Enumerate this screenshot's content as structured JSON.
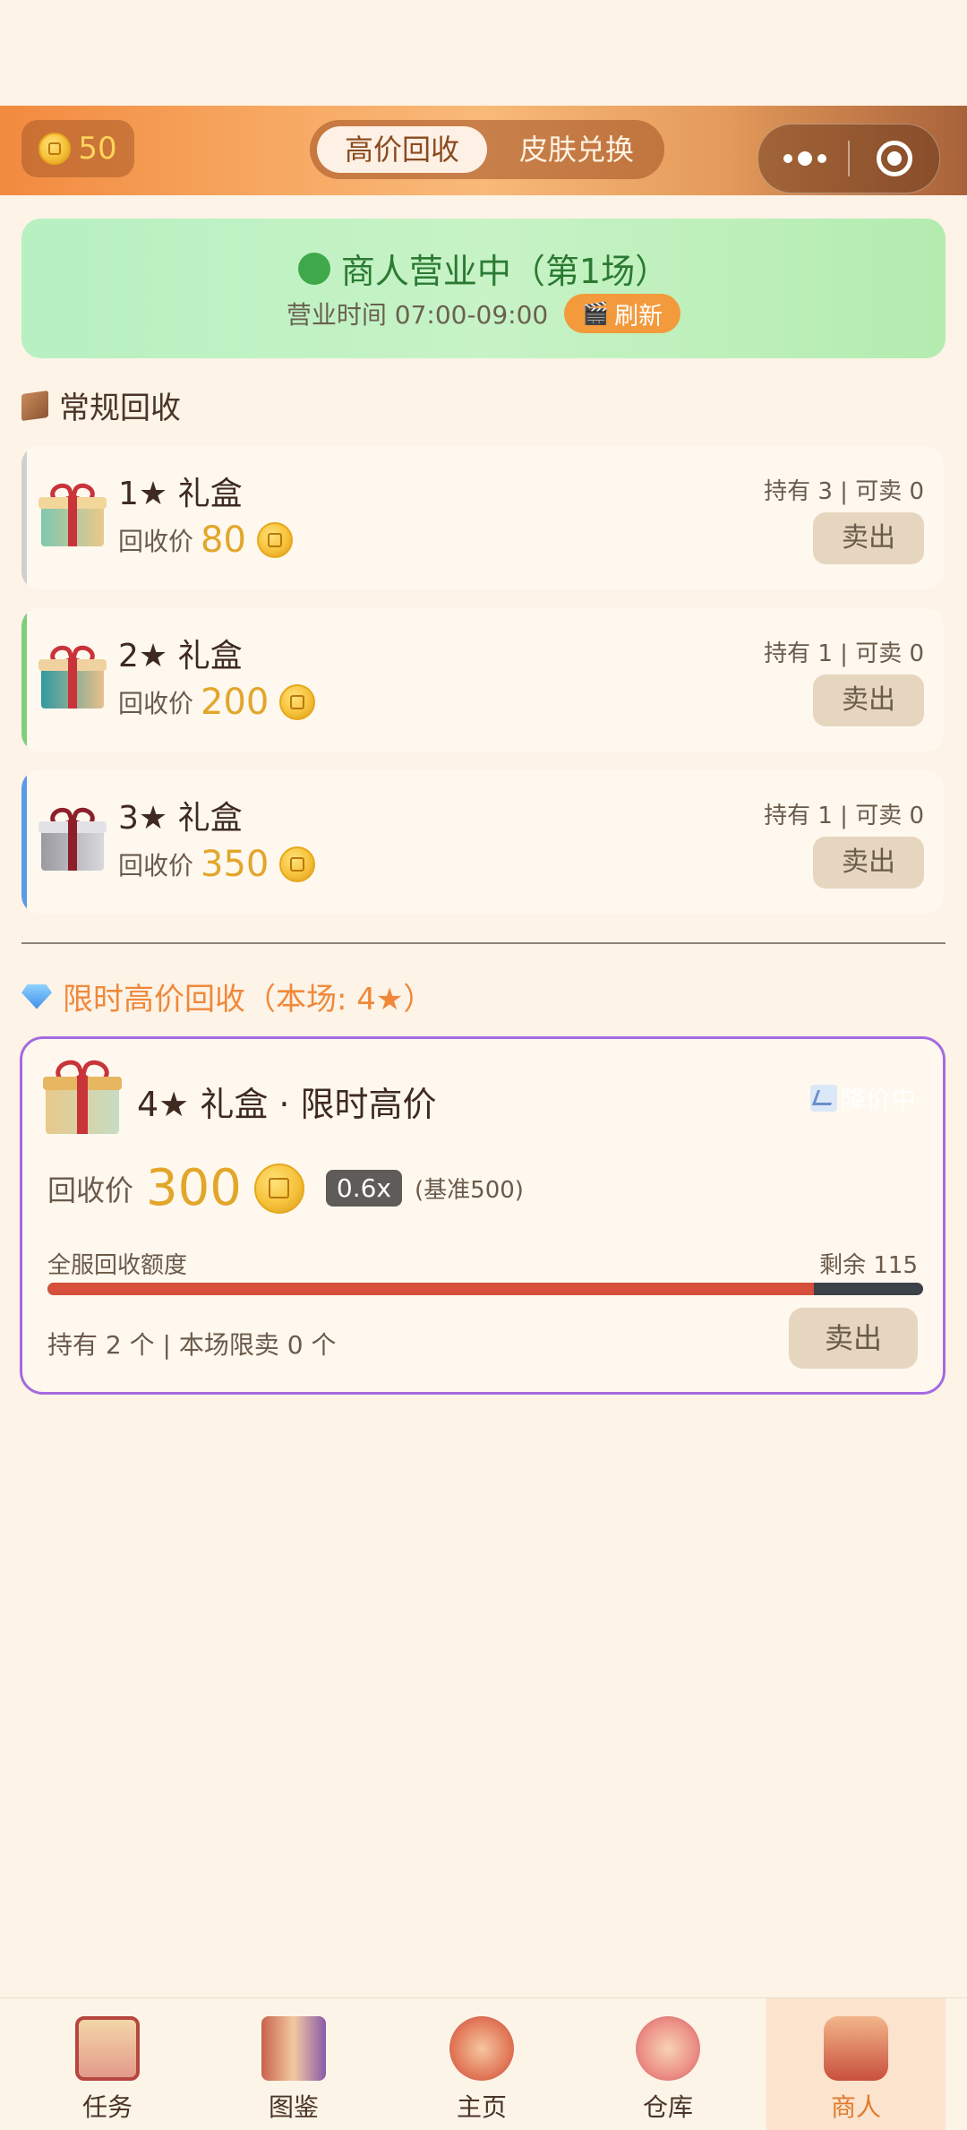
{
  "header": {
    "coin_balance": "50",
    "tabs": [
      "高价回收",
      "皮肤兑换"
    ],
    "active_tab": 0
  },
  "status": {
    "title": "商人营业中（第1场）",
    "hours": "营业时间 07:00-09:00",
    "refresh_label": "刷新"
  },
  "regular": {
    "title": "常规回收",
    "price_label": "回收价",
    "sell_label": "卖出",
    "items": [
      {
        "name": "1★ 礼盒",
        "price": "80",
        "holding": "持有 3 | 可卖 0",
        "accent": "#cccccc"
      },
      {
        "name": "2★ 礼盒",
        "price": "200",
        "holding": "持有 1 | 可卖 0",
        "accent": "#7fcf7a"
      },
      {
        "name": "3★ 礼盒",
        "price": "350",
        "holding": "持有 1 | 可卖 0",
        "accent": "#5b9be8"
      }
    ]
  },
  "limited": {
    "title": "限时高价回收（本场: 4★）",
    "name": "4★ 礼盒 · 限时高价",
    "trend": "降价中",
    "price_label": "回收价",
    "price": "300",
    "multiplier": "0.6x",
    "base": "(基准500)",
    "quota_label": "全服回收额度",
    "remaining": "剩余 115",
    "quota_used_fraction": 0.875,
    "limit_info": "持有 2 个 | 本场限卖 0 个",
    "sell_label": "卖出"
  },
  "tabbar": {
    "items": [
      "任务",
      "图鉴",
      "主页",
      "仓库",
      "商人"
    ],
    "active": 4
  }
}
